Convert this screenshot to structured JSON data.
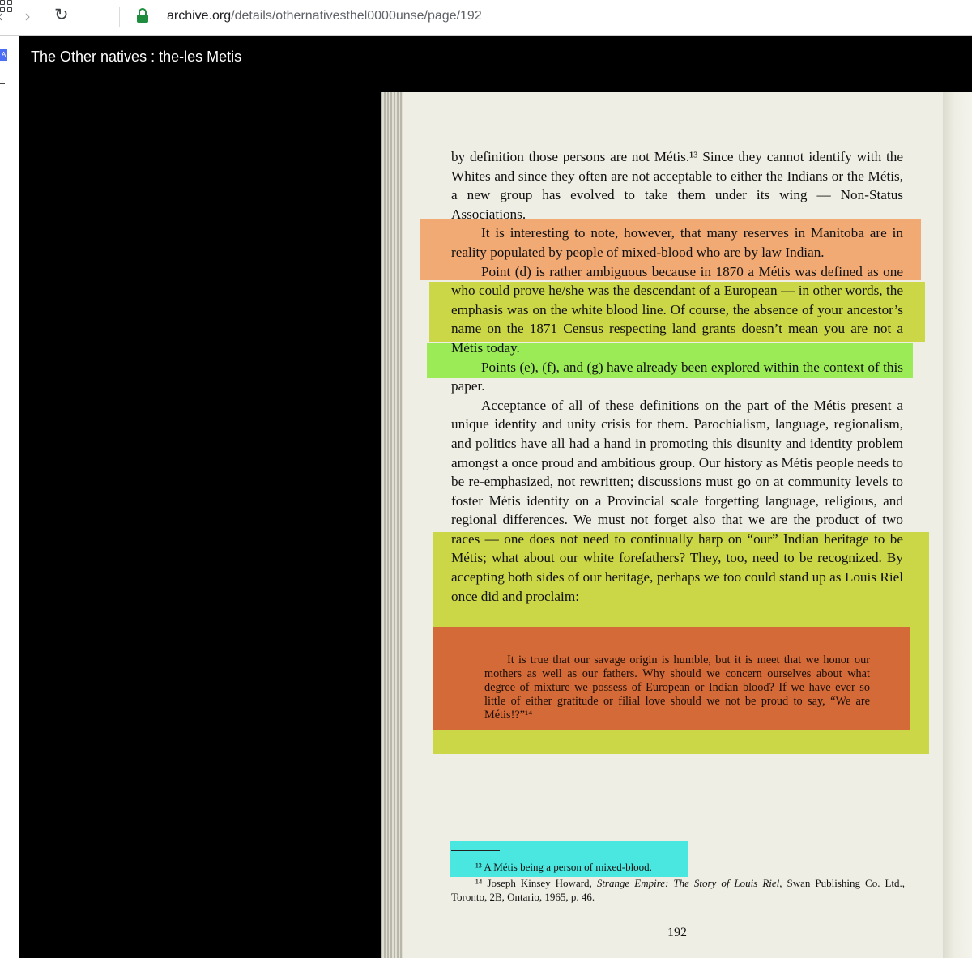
{
  "browser": {
    "url_host": "archive.org",
    "url_path": "/details/othernativesthel0000unse/page/192"
  },
  "viewer": {
    "book_title": "The Other natives : the-les Metis"
  },
  "page": {
    "paragraphs": [
      "by definition those persons are not Métis.¹³ Since they cannot identify with the Whites and since they often are not acceptable to either the Indians or the Métis, a new group has evolved to take them under its wing — Non-Status Associations.",
      "It is interesting to note, however, that many reserves in Manitoba are in reality populated by people of mixed-blood who are by law Indian.",
      "Point (d) is rather ambiguous because in 1870 a Métis was defined as one who could prove he/she was the descendant of a European — in other words, the emphasis was on the white blood line. Of course, the absence of your ancestor’s name on the 1871 Census respecting land grants doesn’t mean you are not a Métis today.",
      "Points (e), (f), and (g) have already been explored within the context of this paper.",
      "Acceptance of all of these definitions on the part of the Métis present a unique identity and unity crisis for them. Parochialism, language, regionalism, and politics have all had a hand in promoting this disunity and identity problem amongst a once proud and ambitious group. Our history as Métis people needs to be re-emphasized, not rewritten; discussions must go on at community levels to foster Métis identity on a Provincial scale forgetting language, religious, and regional differences. We must not forget also that we are the product of two races — one does not need to continually harp on “our” Indian heritage to be Métis; what about our white forefathers? They, too, need to be recognized. By accepting both sides of our heritage, perhaps we too could stand up as Louis Riel once did and proclaim:"
    ],
    "quote": "It is true that our savage origin is humble, but it is meet that we honor our mothers as well as our fathers. Why should we concern ourselves about what degree of mixture we possess of European or Indian blood? If we have ever so little of either gratitude or filial love should we not be proud to say, “We are Métis!?”¹⁴",
    "footnote_13": "¹³ A Métis being a person of mixed-blood.",
    "footnote_14_num": "¹⁴",
    "footnote_14_a": "Joseph Kinsey Howard, ",
    "footnote_14_title": "Strange Empire: The Story of Louis Riel,",
    "footnote_14_b": " Swan Publishing Co. Ltd., Toronto, 2B, Ontario, 1965, p. 46.",
    "page_number": "192"
  },
  "colors": {
    "highlight_orange": "#f2a46a",
    "highlight_yellowgreen": "#c9d53a",
    "highlight_green": "#93ea4a",
    "highlight_red": "#d46438",
    "highlight_cyan": "#3ce6e0"
  }
}
